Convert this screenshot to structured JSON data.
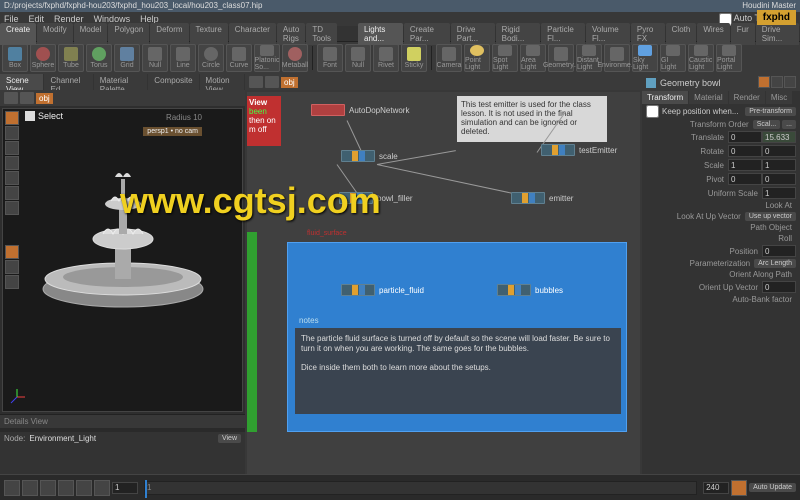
{
  "title_path": "D:/projects/fxphd/fxphd-hou203/fxphd_hou203_local/hou203_class07.hip",
  "app_name": "Houdini Master",
  "auto_takes": "Auto Takes",
  "fxphd": "fxphd",
  "menu": [
    "File",
    "Edit",
    "Render",
    "Windows",
    "Help"
  ],
  "shelf_tabs_left": [
    "Create",
    "Modify",
    "Model",
    "Polygon",
    "Deform",
    "Texture",
    "Character",
    "Auto Rigs",
    "TD Tools"
  ],
  "shelf_tabs_right": [
    "Lights and...",
    "Create Par...",
    "Drive Part...",
    "Rigid Bodi...",
    "Particle Fl...",
    "Volume Fl...",
    "Pyro FX",
    "Cloth",
    "Wires",
    "Fur",
    "Drive Sim..."
  ],
  "tools_left": [
    "Box",
    "Sphere",
    "Tube",
    "Torus",
    "Grid",
    "Null",
    "Line",
    "Circle",
    "Curve",
    "Platonic So...",
    "Metaball"
  ],
  "tools_mid": [
    "Font",
    "Null",
    "Rivet",
    "Sticky"
  ],
  "tools_right": [
    "Camera",
    "Point Light",
    "Spot Light",
    "Area Light",
    "Geometry...",
    "Distant Light",
    "Environme...",
    "Sky Light",
    "GI Light",
    "Caustic Light",
    "Portal Light"
  ],
  "left_tabs": [
    "Scene View",
    "Channel Ed...",
    "Material Palette",
    "Composite ...",
    "Motion View"
  ],
  "obj_path": "obj",
  "select_label": "Select",
  "radius_label": "Radius",
  "radius_val": "10",
  "cam_label": "persp1 • no cam",
  "details_title": "Details View",
  "node_label": "Node:",
  "node_value": "Environment_Light",
  "view_btn": "View",
  "center_obj": "obj",
  "view_block": {
    "title": "View",
    "l1": "been",
    "l2": "then on",
    "l3": "m off"
  },
  "sticky1": "This test emitter is used for the class lesson. It is not used in the final simulation and can be ignored or deleted.",
  "nodes": {
    "autodop": "AutoDopNetwork",
    "scale": "scale",
    "bowl_filler": "bowl_filler",
    "test_emitter": "testEmitter",
    "emitter": "emitter",
    "particle_fluid": "particle_fluid",
    "bubbles": "bubbles"
  },
  "fluid_section": "fluid_surface",
  "notes_label": "notes",
  "notes_text1": "The particle fluid surface is turned off by default so the scene will load faster. Be sure to turn it on when you are working. The same goes for the bubbles.",
  "notes_text2": "Dice inside them both to learn more about the setups.",
  "geom_header": "Geometry bowl",
  "right_tabs": [
    "Transform",
    "Material",
    "Render",
    "Misc"
  ],
  "keep_pos": "Keep position when...",
  "pre_transform": "Pre-transform",
  "transform_order": "Transform Order",
  "scal_btn": "Scal...",
  "params": {
    "translate": {
      "label": "Translate",
      "v0": "0",
      "v1": "15.633"
    },
    "rotate": {
      "label": "Rotate",
      "v0": "0",
      "v1": "0"
    },
    "scale": {
      "label": "Scale",
      "v0": "1",
      "v1": "1"
    },
    "pivot": {
      "label": "Pivot",
      "v0": "0",
      "v1": "0"
    },
    "uniform": {
      "label": "Uniform Scale",
      "v0": "1"
    },
    "lookat": {
      "label": "Look At"
    },
    "lookat_up": {
      "label": "Look At Up Vector",
      "btn": "Use up vector"
    },
    "path_obj": {
      "label": "Path Object"
    },
    "roll": {
      "label": "Roll"
    },
    "position": {
      "label": "Position",
      "v0": "0"
    },
    "param": {
      "label": "Parameterization",
      "btn": "Arc Length"
    },
    "orient_path": {
      "label": "Orient Along Path"
    },
    "orient_up": {
      "label": "Orient Up Vector",
      "v0": "0"
    },
    "auto_bank": {
      "label": "Auto-Bank factor"
    }
  },
  "timeline": {
    "frame": "1",
    "end": "240",
    "auto_update": "Auto Update"
  },
  "watermark": "www.cgtsj.com"
}
